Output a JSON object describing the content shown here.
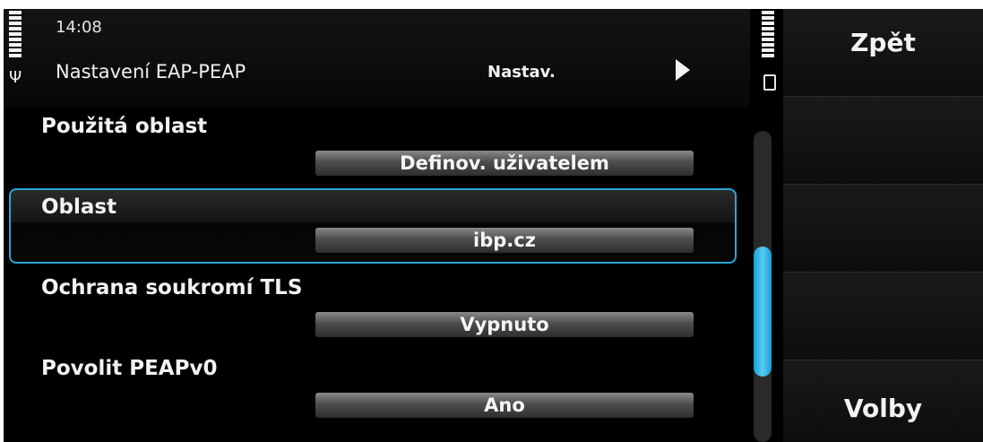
{
  "status": {
    "time": "14:08"
  },
  "header": {
    "title": "Nastavení EAP-PEAP",
    "tab_label": "Nastav."
  },
  "settings": [
    {
      "label": "Použitá oblast",
      "value": "Definov. uživatelem"
    },
    {
      "label": "Oblast",
      "value": "ibp.cz",
      "selected": true
    },
    {
      "label": "Ochrana soukromí TLS",
      "value": "Vypnuto"
    },
    {
      "label": "Povolit PEAPv0",
      "value": "Ano"
    }
  ],
  "softkeys": {
    "back": "Zpět",
    "options": "Volby"
  },
  "colors": {
    "accent": "#2aa6d8",
    "background": "#000000",
    "text": "#f2f2f2"
  },
  "scroll": {
    "position_fraction": 0.4,
    "visible_fraction": 0.42
  }
}
